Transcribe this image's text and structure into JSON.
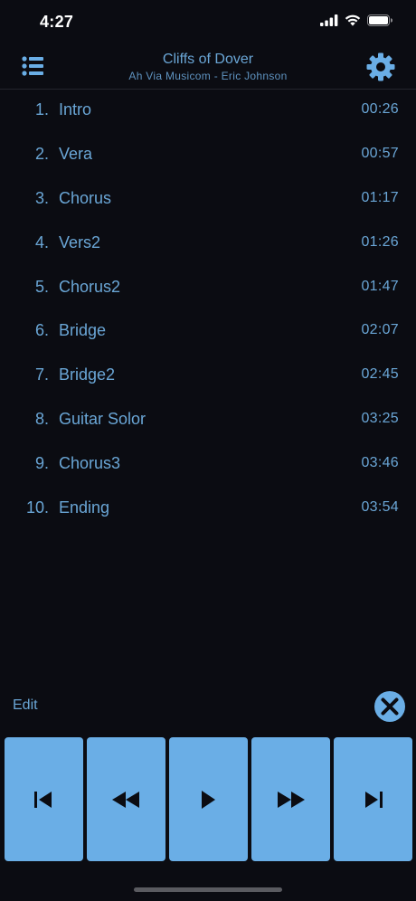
{
  "status_bar": {
    "time": "4:27"
  },
  "nav": {
    "title": "Cliffs of Dover",
    "subtitle": "Ah Via Musicom - Eric Johnson",
    "left_icon": "list-icon",
    "right_icon": "gear-icon"
  },
  "sections": [
    {
      "number": "1.",
      "name": "Intro",
      "time": "00:26"
    },
    {
      "number": "2.",
      "name": "Vera",
      "time": "00:57"
    },
    {
      "number": "3.",
      "name": "Chorus",
      "time": "01:17"
    },
    {
      "number": "4.",
      "name": "Vers2",
      "time": "01:26"
    },
    {
      "number": "5.",
      "name": "Chorus2",
      "time": "01:47"
    },
    {
      "number": "6.",
      "name": "Bridge",
      "time": "02:07"
    },
    {
      "number": "7.",
      "name": "Bridge2",
      "time": "02:45"
    },
    {
      "number": "8.",
      "name": "Guitar Solor",
      "time": "03:25"
    },
    {
      "number": "9.",
      "name": "Chorus3",
      "time": "03:46"
    },
    {
      "number": "10.",
      "name": "Ending",
      "time": "03:54"
    }
  ],
  "footer": {
    "edit_label": "Edit",
    "close_icon": "close-icon"
  },
  "controls": [
    {
      "icon": "skip-previous-icon"
    },
    {
      "icon": "rewind-icon"
    },
    {
      "icon": "play-icon"
    },
    {
      "icon": "fast-forward-icon"
    },
    {
      "icon": "skip-next-icon"
    }
  ],
  "colors": {
    "background": "#0b0c12",
    "accent": "#6aa6d6",
    "button_fill": "#6aaee6",
    "button_icon": "#0b0c12"
  }
}
